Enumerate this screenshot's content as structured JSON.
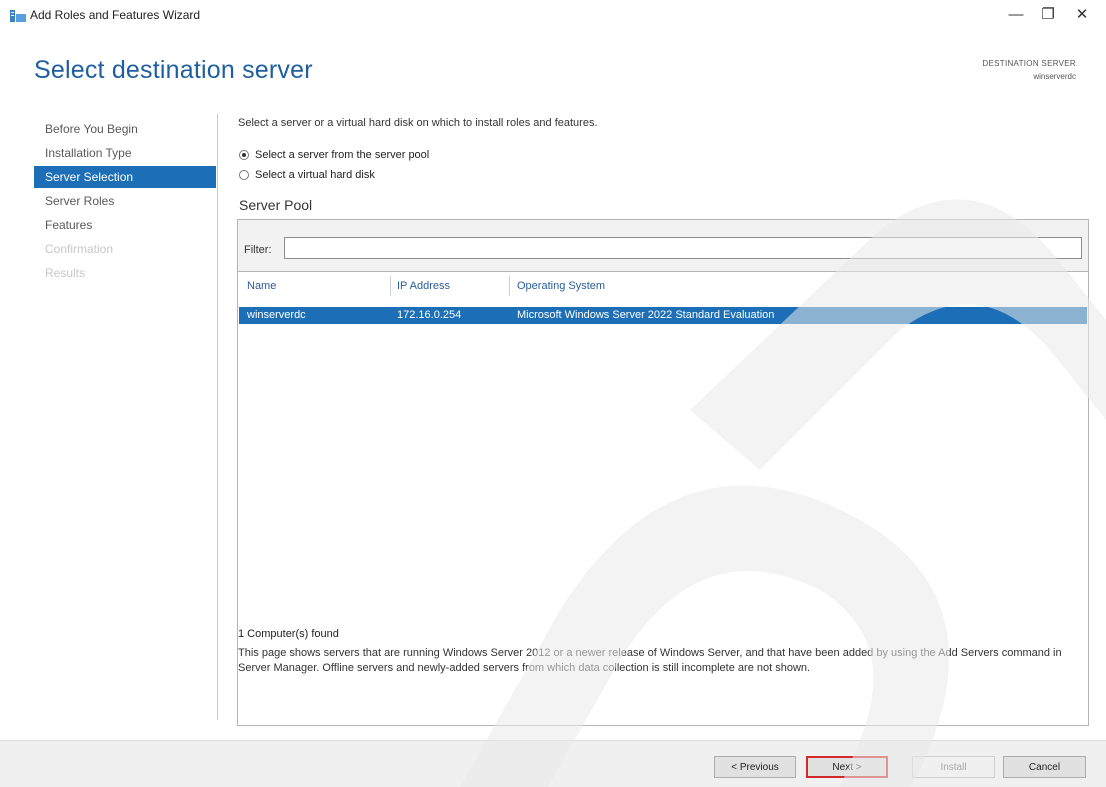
{
  "window": {
    "title": "Add Roles and Features Wizard",
    "minimize_glyph": "—",
    "maximize_glyph": "❐",
    "close_glyph": "✕"
  },
  "header": {
    "page_title": "Select destination server",
    "destination_label": "DESTINATION SERVER",
    "destination_value": "winserverdc"
  },
  "nav": {
    "items": [
      {
        "label": "Before You Begin",
        "state": "normal"
      },
      {
        "label": "Installation Type",
        "state": "normal"
      },
      {
        "label": "Server Selection",
        "state": "active"
      },
      {
        "label": "Server Roles",
        "state": "normal"
      },
      {
        "label": "Features",
        "state": "normal"
      },
      {
        "label": "Confirmation",
        "state": "disabled"
      },
      {
        "label": "Results",
        "state": "disabled"
      }
    ]
  },
  "main": {
    "intro": "Select a server or a virtual hard disk on which to install roles and features.",
    "options": [
      {
        "label": "Select a server from the server pool",
        "checked": true
      },
      {
        "label": "Select a virtual hard disk",
        "checked": false
      }
    ],
    "pool_title": "Server Pool",
    "filter_label": "Filter:",
    "filter_value": "",
    "columns": [
      "Name",
      "IP Address",
      "Operating System"
    ],
    "rows": [
      {
        "name": "winserverdc",
        "ip": "172.16.0.254",
        "os": "Microsoft Windows Server 2022 Standard Evaluation",
        "selected": true
      }
    ],
    "found_text": "1 Computer(s) found",
    "note": "This page shows servers that are running Windows Server 2012 or a newer release of Windows Server, and that have been added by using the Add Servers command in Server Manager. Offline servers and newly-added servers from which data collection is still incomplete are not shown."
  },
  "footer": {
    "previous": "< Previous",
    "next": "Next >",
    "install": "Install",
    "cancel": "Cancel"
  },
  "colors": {
    "accent": "#1c6fb7",
    "title_blue": "#1f5fa0",
    "highlight_border": "#d22a2a"
  },
  "icons": [
    "server-manager-icon",
    "minimize-icon",
    "maximize-icon",
    "close-icon"
  ]
}
